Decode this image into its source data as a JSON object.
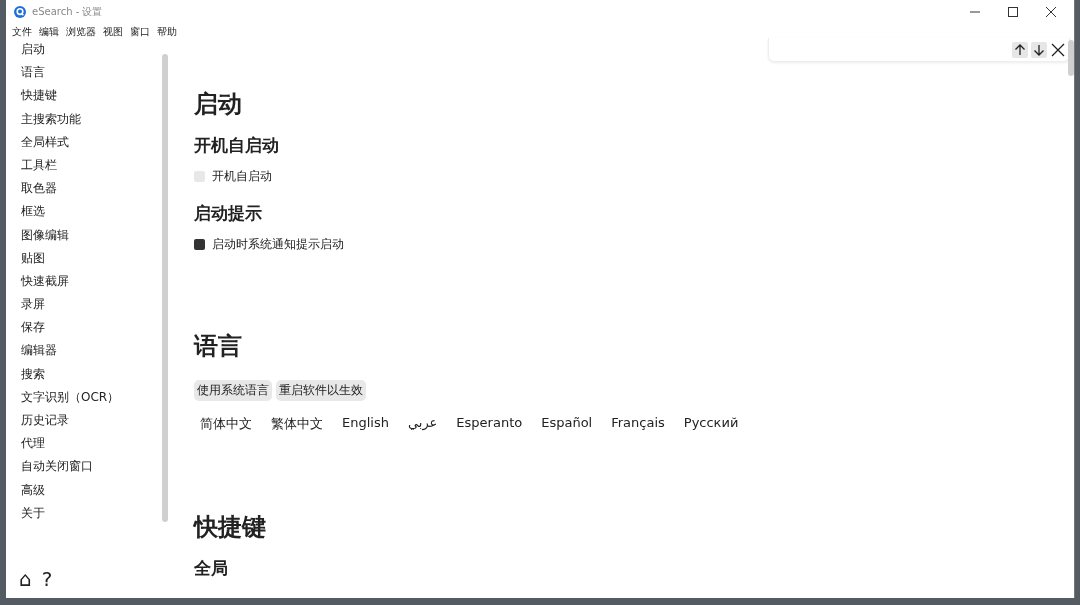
{
  "window": {
    "title": "eSearch - 设置"
  },
  "menu": [
    "文件",
    "编辑",
    "浏览器",
    "视图",
    "窗口",
    "帮助"
  ],
  "sidebar": {
    "items": [
      "启动",
      "语言",
      "快捷键",
      "主搜索功能",
      "全局样式",
      "工具栏",
      "取色器",
      "框选",
      "图像编辑",
      "贴图",
      "快速截屏",
      "录屏",
      "保存",
      "编辑器",
      "搜索",
      "文字识别（OCR）",
      "历史记录",
      "代理",
      "自动关闭窗口",
      "高级",
      "关于"
    ],
    "footer": [
      "⌂",
      "?"
    ]
  },
  "find_bar": {
    "buttons": [
      {
        "kind": "up"
      },
      {
        "kind": "down"
      },
      {
        "kind": "close"
      }
    ]
  },
  "sections": [
    {
      "title": "启动",
      "subsections": [
        {
          "title": "开机自启动",
          "checkbox": {
            "label": "开机自启动",
            "checked": false
          }
        },
        {
          "title": "启动提示",
          "checkbox": {
            "label": "启动时系统通知提示启动",
            "checked": true
          }
        }
      ]
    },
    {
      "title": "语言",
      "buttons": [
        "使用系统语言",
        "重启软件以生效"
      ],
      "languages": [
        "简体中文",
        "繁体中文",
        "English",
        "عربي",
        "Esperanto",
        "Español",
        "Français",
        "Русский"
      ]
    },
    {
      "title": "快捷键",
      "subsections": [
        {
          "title": "全局"
        }
      ]
    }
  ]
}
